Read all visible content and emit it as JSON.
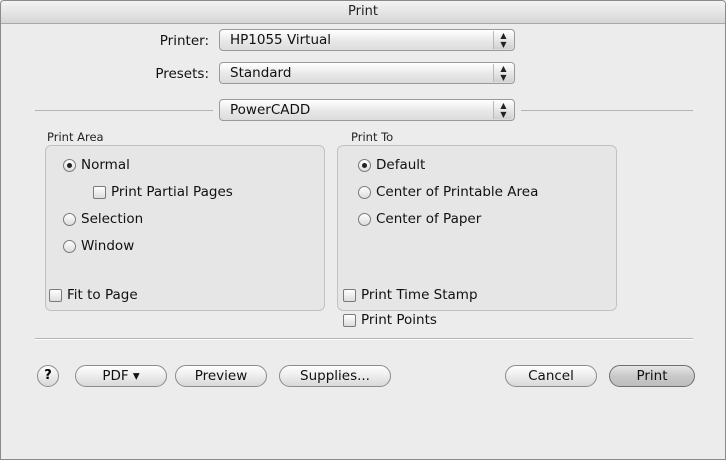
{
  "window": {
    "title": "Print"
  },
  "printer": {
    "label": "Printer:",
    "value": "HP1055 Virtual"
  },
  "presets": {
    "label": "Presets:",
    "value": "Standard"
  },
  "panel": {
    "value": "PowerCADD"
  },
  "print_area": {
    "title": "Print Area",
    "normal": {
      "label": "Normal",
      "selected": true
    },
    "partial_pages": {
      "label": "Print Partial Pages",
      "checked": false
    },
    "selection": {
      "label": "Selection",
      "selected": false
    },
    "window": {
      "label": "Window",
      "selected": false
    }
  },
  "print_to": {
    "title": "Print To",
    "default": {
      "label": "Default",
      "selected": true
    },
    "center_printable": {
      "label": "Center of Printable Area",
      "selected": false
    },
    "center_paper": {
      "label": "Center of Paper",
      "selected": false
    }
  },
  "options": {
    "fit_to_page": {
      "label": "Fit to Page",
      "checked": false
    },
    "time_stamp": {
      "label": "Print Time Stamp",
      "checked": false
    },
    "print_points": {
      "label": "Print Points",
      "checked": false
    }
  },
  "buttons": {
    "help": "?",
    "pdf": "PDF ▾",
    "preview": "Preview",
    "supplies": "Supplies...",
    "cancel": "Cancel",
    "print": "Print"
  }
}
